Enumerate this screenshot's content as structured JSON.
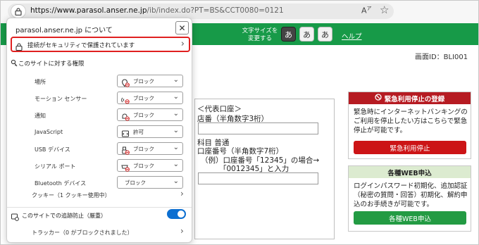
{
  "browser": {
    "url_domain": "https://www.parasol.anser.ne.jp",
    "url_path": "/ib/index.do?PT=BS&CCT0080=0121",
    "read_aloud_icon": "read-aloud-icon",
    "favorite_icon": "star-icon"
  },
  "site_header": {
    "font_size_label_line1": "文字サイズを",
    "font_size_label_line2": "変更する",
    "font_size_buttons": [
      "あ",
      "あ",
      "あ"
    ],
    "help_link": "ヘルプ",
    "brand_color": "#179a48"
  },
  "page": {
    "screen_id": "画面ID：BLI001",
    "account": {
      "heading": "＜代表口座＞",
      "branch_label": "店番（半角数字3桁）",
      "account_type": "科目  普通",
      "account_number_label": "口座番号（半角数字7桁）",
      "example_line1": "（例）口座番号「12345」の場合→",
      "example_line2": "「0012345」と入力"
    },
    "emergency_stop": {
      "heading": "緊急利用停止の登録",
      "description": "緊急時にインターネットバンキングのご利用を停止したい方はこちらで緊急停止が可能です。",
      "button": "緊急利用停止",
      "color": "#b61b22"
    },
    "web_application": {
      "heading": "各種WEB申込",
      "description": "ログインパスワード初期化、追加認証（秘密の質問・回答）初期化、解約申込のお手続きが可能です。",
      "button": "各種WEB申込",
      "color": "#239b43"
    }
  },
  "site_info_popup": {
    "title": "parasol.anser.ne.jp について",
    "close_icon": "close-icon",
    "connection_label": "接続がセキュリティで保護されています",
    "permissions_heading": "このサイトに対する権限",
    "permissions": [
      {
        "label": "場所",
        "value": "ブロック",
        "icon": "location-blocked-icon"
      },
      {
        "label": "モーション センサー",
        "value": "ブロック",
        "icon": "motion-sensor-blocked-icon"
      },
      {
        "label": "通知",
        "value": "ブロック",
        "icon": "notification-blocked-icon"
      },
      {
        "label": "JavaScript",
        "value": "許可",
        "icon": "javascript-icon"
      },
      {
        "label": "USB デバイス",
        "value": "ブロック",
        "icon": "usb-blocked-icon"
      },
      {
        "label": "シリアル ポート",
        "value": "ブロック",
        "icon": "serial-port-blocked-icon"
      },
      {
        "label": "Bluetooth デバイス",
        "value": "ブロック",
        "icon": ""
      }
    ],
    "cookies_label": "クッキー（1 クッキー使用中）",
    "tracking_label": "このサイトでの追跡防止（厳重）",
    "tracking_enabled": true,
    "tracker_label": "トラッカー（0 がブロックされました）"
  }
}
